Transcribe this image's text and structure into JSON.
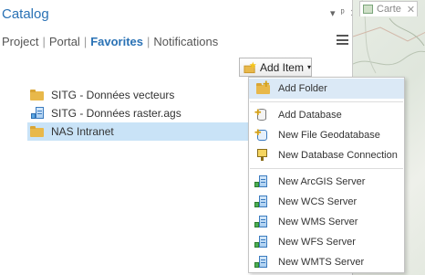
{
  "pane": {
    "title": "Catalog",
    "controls": {
      "dropdown": "▾",
      "pin": "ᵖ",
      "close": "✕"
    }
  },
  "nav": {
    "tabs": [
      "Project",
      "Portal",
      "Favorites",
      "Notifications"
    ],
    "active": "Favorites"
  },
  "toolbar": {
    "add_item_label": "Add Item",
    "caret": "▾"
  },
  "favorites": [
    {
      "label": "SITG - Données vecteurs",
      "icon": "folder-icon"
    },
    {
      "label": "SITG - Données raster.ags",
      "icon": "arcgis-server-connection-icon"
    },
    {
      "label": "NAS Intranet",
      "icon": "folder-icon",
      "selected": true
    }
  ],
  "map_tab": {
    "label": "Carte",
    "close": "✕"
  },
  "menu": {
    "items": [
      {
        "label": "Add Folder",
        "icon": "add-folder-icon"
      },
      {
        "label": "Add Database",
        "icon": "add-database-icon"
      },
      {
        "label": "New File Geodatabase",
        "icon": "file-geodatabase-icon"
      },
      {
        "label": "New Database Connection",
        "icon": "database-connection-icon"
      },
      {
        "label": "New ArcGIS Server",
        "icon": "arcgis-server-icon"
      },
      {
        "label": "New WCS Server",
        "icon": "wcs-server-icon"
      },
      {
        "label": "New WMS Server",
        "icon": "wms-server-icon"
      },
      {
        "label": "New WFS Server",
        "icon": "wfs-server-icon"
      },
      {
        "label": "New WMTS Server",
        "icon": "wmts-server-icon"
      }
    ]
  },
  "colors": {
    "accent": "#2a72b5",
    "selection": "#c9e3f7",
    "menu_hot": "#dbe9f6",
    "folder": "#e8b84a"
  }
}
